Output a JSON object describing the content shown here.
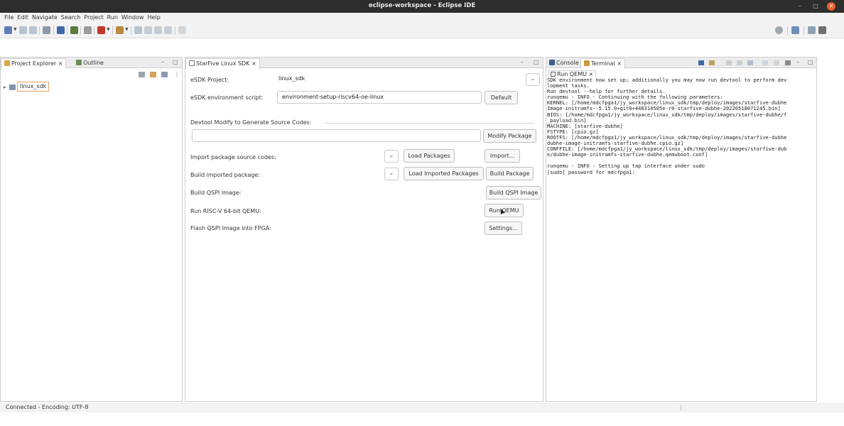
{
  "window": {
    "title": "eclipse-workspace - Eclipse IDE",
    "close_label": "✕",
    "max_label": "□",
    "min_label": "–"
  },
  "menu": [
    "File",
    "Edit",
    "Navigate",
    "Search",
    "Project",
    "Run",
    "Window",
    "Help"
  ],
  "left_pane": {
    "tabs": [
      {
        "label": "Project Explorer ×"
      },
      {
        "label": "Outline"
      }
    ],
    "tree_item": "linux_sdk",
    "min_label": "–",
    "max_label": "□"
  },
  "editor": {
    "tab_label": "StarFive Linux SDK ×",
    "esdk_project_label": "eSDK Project:",
    "esdk_project_value": "linux_sdk",
    "env_script_label": "eSDK environment script:",
    "env_script_value": "environment-setup-riscv64-oe-linux",
    "default_button": "Default",
    "devtool_label": "Devtool Modify to Generate Source Codes:",
    "modify_package_button": "Modify Package",
    "import_src_label": "Import package source codes:",
    "load_packages_button": "Load Packages",
    "import_button": "Import...",
    "build_imported_label": "Build imported package:",
    "load_imported_button": "Load Imported Packages",
    "build_package_button": "Build Package",
    "build_qspi_label": "Build QSPI Image:",
    "build_qspi_button": "Build QSPI Image",
    "run_qemu_label": "Run RISC-V 64-bit QEMU:",
    "run_qemu_button": "Run QEMU",
    "flash_label": "Flash QSPI Image into FPGA:",
    "settings_button": "Settings...",
    "chevron": "⌵"
  },
  "console": {
    "tabs": [
      {
        "label": "Console"
      },
      {
        "label": "Terminal ×"
      }
    ],
    "subtab": "Run QEMU ×",
    "lines": [
      "SDK environment now set up; additionally you may now run devtool to perform dev",
      "lopment tasks.",
      "Run devtool --help for further details.",
      "runqemu - INFO - Continuing with the following parameters:",
      "KERNEL: [/home/mdcfpga1/jy_workspace/linux_sdk/tmp/deploy/images/starfive-dubhe",
      "Image-initramfs--5.15.0+git0+448310505e-r0-starfive-dubhe-20220518071245.bin]",
      "BIOS: [/home/mdcfpga1/jy_workspace/linux_sdk/tmp/deploy/images/starfive-dubhe/f",
      "_payload.bin]",
      "MACHINE: [starfive-dubhe]",
      "FSTYPE: [cpio.gz]",
      "ROOTFS: [/home/mdcfpga1/jy_workspace/linux_sdk/tmp/deploy/images/starfive-dubhe",
      "dubhe-image-initramfs-starfive-dubhe.cpio.gz]",
      "CONFFILE: [/home/mdcfpga1/jy_workspace/linux_sdk/tmp/deploy/images/starfive-dub",
      "e/dubhe-image-initramfs-starfive-dubhe.qemuboot.conf]",
      "",
      "runqemu - INFO - Setting up tap interface under sudo",
      "[sudo] password for mdcfpga1:"
    ]
  },
  "status": {
    "text": "Connected - Encoding: UTF-8"
  },
  "colors": {
    "titlebar": "#2d2d2d",
    "close": "#e8602a",
    "selection_border": "#e8a060"
  }
}
